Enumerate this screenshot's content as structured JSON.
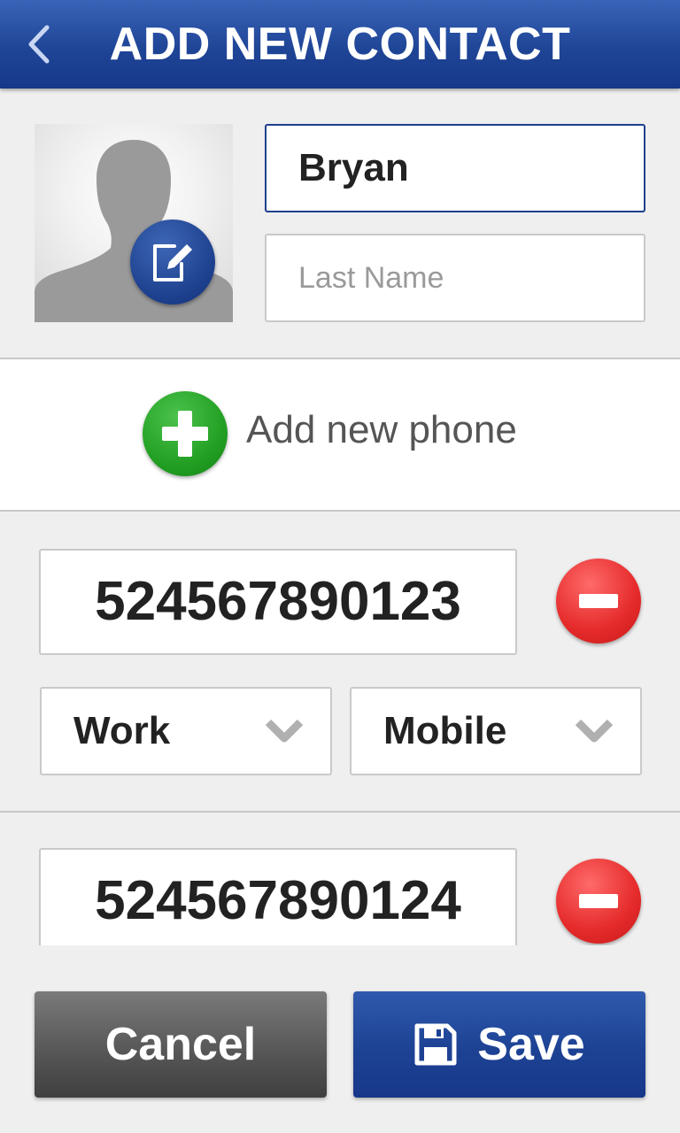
{
  "header": {
    "title": "ADD NEW CONTACT",
    "back_icon": "chevron-left-icon"
  },
  "contact": {
    "avatar_icon": "person-silhouette-icon",
    "edit_icon": "edit-photo-icon",
    "first_name_value": "Bryan",
    "last_name_placeholder": "Last Name"
  },
  "add_phone": {
    "label": "Add new phone",
    "icon": "plus-icon"
  },
  "phones": [
    {
      "number": "524567890123",
      "type": "Work",
      "kind": "Mobile"
    },
    {
      "number": "524567890124"
    }
  ],
  "footer": {
    "cancel_label": "Cancel",
    "save_label": "Save",
    "save_icon": "floppy-disk-icon"
  },
  "colors": {
    "header": "#1f4596",
    "add": "#23a023",
    "remove": "#e52a2a",
    "cancel": "#555555",
    "save": "#1d4294"
  }
}
